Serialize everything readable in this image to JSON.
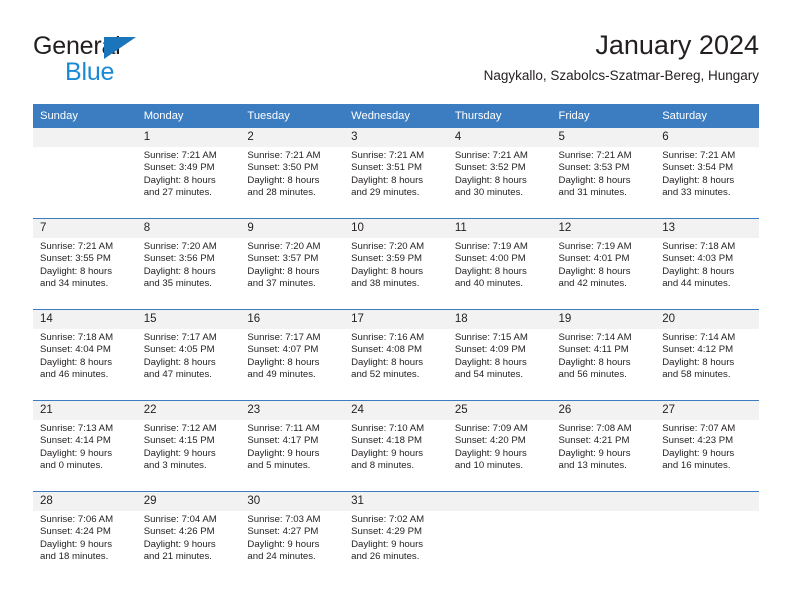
{
  "brand": {
    "name_primary": "General",
    "name_secondary": "Blue",
    "triangle_color": "#1b75bb",
    "secondary_color": "#1b8ad6"
  },
  "header": {
    "title": "January 2024",
    "subtitle": "Nagykallo, Szabolcs-Szatmar-Bereg, Hungary"
  },
  "theme": {
    "header_bar_color": "#3b7dc0",
    "daynum_band_color": "#f2f2f2",
    "text_color": "#231f20"
  },
  "weekdays": [
    "Sunday",
    "Monday",
    "Tuesday",
    "Wednesday",
    "Thursday",
    "Friday",
    "Saturday"
  ],
  "weeks": [
    [
      {
        "day": "",
        "sunrise": "",
        "sunset": "",
        "daylight_line1": "",
        "daylight_line2": "",
        "empty": true
      },
      {
        "day": "1",
        "sunrise": "Sunrise: 7:21 AM",
        "sunset": "Sunset: 3:49 PM",
        "daylight_line1": "Daylight: 8 hours",
        "daylight_line2": "and 27 minutes."
      },
      {
        "day": "2",
        "sunrise": "Sunrise: 7:21 AM",
        "sunset": "Sunset: 3:50 PM",
        "daylight_line1": "Daylight: 8 hours",
        "daylight_line2": "and 28 minutes."
      },
      {
        "day": "3",
        "sunrise": "Sunrise: 7:21 AM",
        "sunset": "Sunset: 3:51 PM",
        "daylight_line1": "Daylight: 8 hours",
        "daylight_line2": "and 29 minutes."
      },
      {
        "day": "4",
        "sunrise": "Sunrise: 7:21 AM",
        "sunset": "Sunset: 3:52 PM",
        "daylight_line1": "Daylight: 8 hours",
        "daylight_line2": "and 30 minutes."
      },
      {
        "day": "5",
        "sunrise": "Sunrise: 7:21 AM",
        "sunset": "Sunset: 3:53 PM",
        "daylight_line1": "Daylight: 8 hours",
        "daylight_line2": "and 31 minutes."
      },
      {
        "day": "6",
        "sunrise": "Sunrise: 7:21 AM",
        "sunset": "Sunset: 3:54 PM",
        "daylight_line1": "Daylight: 8 hours",
        "daylight_line2": "and 33 minutes."
      }
    ],
    [
      {
        "day": "7",
        "sunrise": "Sunrise: 7:21 AM",
        "sunset": "Sunset: 3:55 PM",
        "daylight_line1": "Daylight: 8 hours",
        "daylight_line2": "and 34 minutes."
      },
      {
        "day": "8",
        "sunrise": "Sunrise: 7:20 AM",
        "sunset": "Sunset: 3:56 PM",
        "daylight_line1": "Daylight: 8 hours",
        "daylight_line2": "and 35 minutes."
      },
      {
        "day": "9",
        "sunrise": "Sunrise: 7:20 AM",
        "sunset": "Sunset: 3:57 PM",
        "daylight_line1": "Daylight: 8 hours",
        "daylight_line2": "and 37 minutes."
      },
      {
        "day": "10",
        "sunrise": "Sunrise: 7:20 AM",
        "sunset": "Sunset: 3:59 PM",
        "daylight_line1": "Daylight: 8 hours",
        "daylight_line2": "and 38 minutes."
      },
      {
        "day": "11",
        "sunrise": "Sunrise: 7:19 AM",
        "sunset": "Sunset: 4:00 PM",
        "daylight_line1": "Daylight: 8 hours",
        "daylight_line2": "and 40 minutes."
      },
      {
        "day": "12",
        "sunrise": "Sunrise: 7:19 AM",
        "sunset": "Sunset: 4:01 PM",
        "daylight_line1": "Daylight: 8 hours",
        "daylight_line2": "and 42 minutes."
      },
      {
        "day": "13",
        "sunrise": "Sunrise: 7:18 AM",
        "sunset": "Sunset: 4:03 PM",
        "daylight_line1": "Daylight: 8 hours",
        "daylight_line2": "and 44 minutes."
      }
    ],
    [
      {
        "day": "14",
        "sunrise": "Sunrise: 7:18 AM",
        "sunset": "Sunset: 4:04 PM",
        "daylight_line1": "Daylight: 8 hours",
        "daylight_line2": "and 46 minutes."
      },
      {
        "day": "15",
        "sunrise": "Sunrise: 7:17 AM",
        "sunset": "Sunset: 4:05 PM",
        "daylight_line1": "Daylight: 8 hours",
        "daylight_line2": "and 47 minutes."
      },
      {
        "day": "16",
        "sunrise": "Sunrise: 7:17 AM",
        "sunset": "Sunset: 4:07 PM",
        "daylight_line1": "Daylight: 8 hours",
        "daylight_line2": "and 49 minutes."
      },
      {
        "day": "17",
        "sunrise": "Sunrise: 7:16 AM",
        "sunset": "Sunset: 4:08 PM",
        "daylight_line1": "Daylight: 8 hours",
        "daylight_line2": "and 52 minutes."
      },
      {
        "day": "18",
        "sunrise": "Sunrise: 7:15 AM",
        "sunset": "Sunset: 4:09 PM",
        "daylight_line1": "Daylight: 8 hours",
        "daylight_line2": "and 54 minutes."
      },
      {
        "day": "19",
        "sunrise": "Sunrise: 7:14 AM",
        "sunset": "Sunset: 4:11 PM",
        "daylight_line1": "Daylight: 8 hours",
        "daylight_line2": "and 56 minutes."
      },
      {
        "day": "20",
        "sunrise": "Sunrise: 7:14 AM",
        "sunset": "Sunset: 4:12 PM",
        "daylight_line1": "Daylight: 8 hours",
        "daylight_line2": "and 58 minutes."
      }
    ],
    [
      {
        "day": "21",
        "sunrise": "Sunrise: 7:13 AM",
        "sunset": "Sunset: 4:14 PM",
        "daylight_line1": "Daylight: 9 hours",
        "daylight_line2": "and 0 minutes."
      },
      {
        "day": "22",
        "sunrise": "Sunrise: 7:12 AM",
        "sunset": "Sunset: 4:15 PM",
        "daylight_line1": "Daylight: 9 hours",
        "daylight_line2": "and 3 minutes."
      },
      {
        "day": "23",
        "sunrise": "Sunrise: 7:11 AM",
        "sunset": "Sunset: 4:17 PM",
        "daylight_line1": "Daylight: 9 hours",
        "daylight_line2": "and 5 minutes."
      },
      {
        "day": "24",
        "sunrise": "Sunrise: 7:10 AM",
        "sunset": "Sunset: 4:18 PM",
        "daylight_line1": "Daylight: 9 hours",
        "daylight_line2": "and 8 minutes."
      },
      {
        "day": "25",
        "sunrise": "Sunrise: 7:09 AM",
        "sunset": "Sunset: 4:20 PM",
        "daylight_line1": "Daylight: 9 hours",
        "daylight_line2": "and 10 minutes."
      },
      {
        "day": "26",
        "sunrise": "Sunrise: 7:08 AM",
        "sunset": "Sunset: 4:21 PM",
        "daylight_line1": "Daylight: 9 hours",
        "daylight_line2": "and 13 minutes."
      },
      {
        "day": "27",
        "sunrise": "Sunrise: 7:07 AM",
        "sunset": "Sunset: 4:23 PM",
        "daylight_line1": "Daylight: 9 hours",
        "daylight_line2": "and 16 minutes."
      }
    ],
    [
      {
        "day": "28",
        "sunrise": "Sunrise: 7:06 AM",
        "sunset": "Sunset: 4:24 PM",
        "daylight_line1": "Daylight: 9 hours",
        "daylight_line2": "and 18 minutes."
      },
      {
        "day": "29",
        "sunrise": "Sunrise: 7:04 AM",
        "sunset": "Sunset: 4:26 PM",
        "daylight_line1": "Daylight: 9 hours",
        "daylight_line2": "and 21 minutes."
      },
      {
        "day": "30",
        "sunrise": "Sunrise: 7:03 AM",
        "sunset": "Sunset: 4:27 PM",
        "daylight_line1": "Daylight: 9 hours",
        "daylight_line2": "and 24 minutes."
      },
      {
        "day": "31",
        "sunrise": "Sunrise: 7:02 AM",
        "sunset": "Sunset: 4:29 PM",
        "daylight_line1": "Daylight: 9 hours",
        "daylight_line2": "and 26 minutes."
      },
      {
        "day": "",
        "sunrise": "",
        "sunset": "",
        "daylight_line1": "",
        "daylight_line2": "",
        "empty": true
      },
      {
        "day": "",
        "sunrise": "",
        "sunset": "",
        "daylight_line1": "",
        "daylight_line2": "",
        "empty": true
      },
      {
        "day": "",
        "sunrise": "",
        "sunset": "",
        "daylight_line1": "",
        "daylight_line2": "",
        "empty": true
      }
    ]
  ]
}
